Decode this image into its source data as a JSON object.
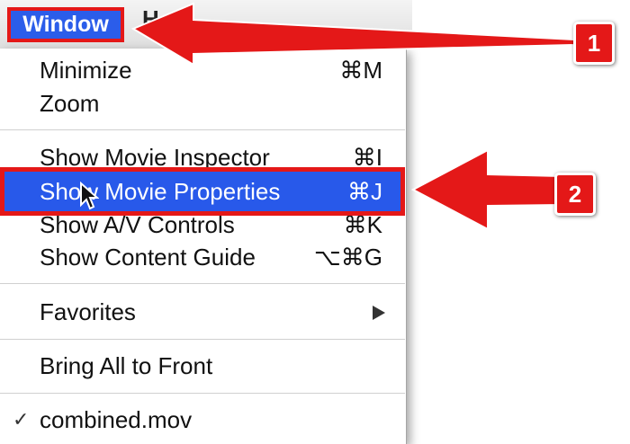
{
  "menubar": {
    "active_menu": "Window",
    "next_menu_partial": "H"
  },
  "menu": {
    "items": [
      {
        "label": "Minimize",
        "shortcut": "⌘M"
      },
      {
        "label": "Zoom",
        "shortcut": ""
      },
      {
        "label": "Show Movie Inspector",
        "shortcut": "⌘I"
      },
      {
        "label": "Show Movie Properties",
        "shortcut": "⌘J"
      },
      {
        "label": "Show A/V Controls",
        "shortcut": "⌘K"
      },
      {
        "label": "Show Content Guide",
        "shortcut": "⌥⌘G"
      },
      {
        "label": "Favorites",
        "shortcut": ""
      },
      {
        "label": "Bring All to Front",
        "shortcut": ""
      },
      {
        "label": "combined.mov",
        "shortcut": "",
        "checked": true
      }
    ]
  },
  "callouts": [
    {
      "number": "1",
      "target": "Window menu"
    },
    {
      "number": "2",
      "target": "Show Movie Properties"
    }
  ],
  "colors": {
    "highlight": "#2859ea",
    "annotation_red": "#e41818"
  },
  "icons": [
    "submenu-arrow-icon",
    "checkmark-icon",
    "mouse-pointer-icon"
  ]
}
